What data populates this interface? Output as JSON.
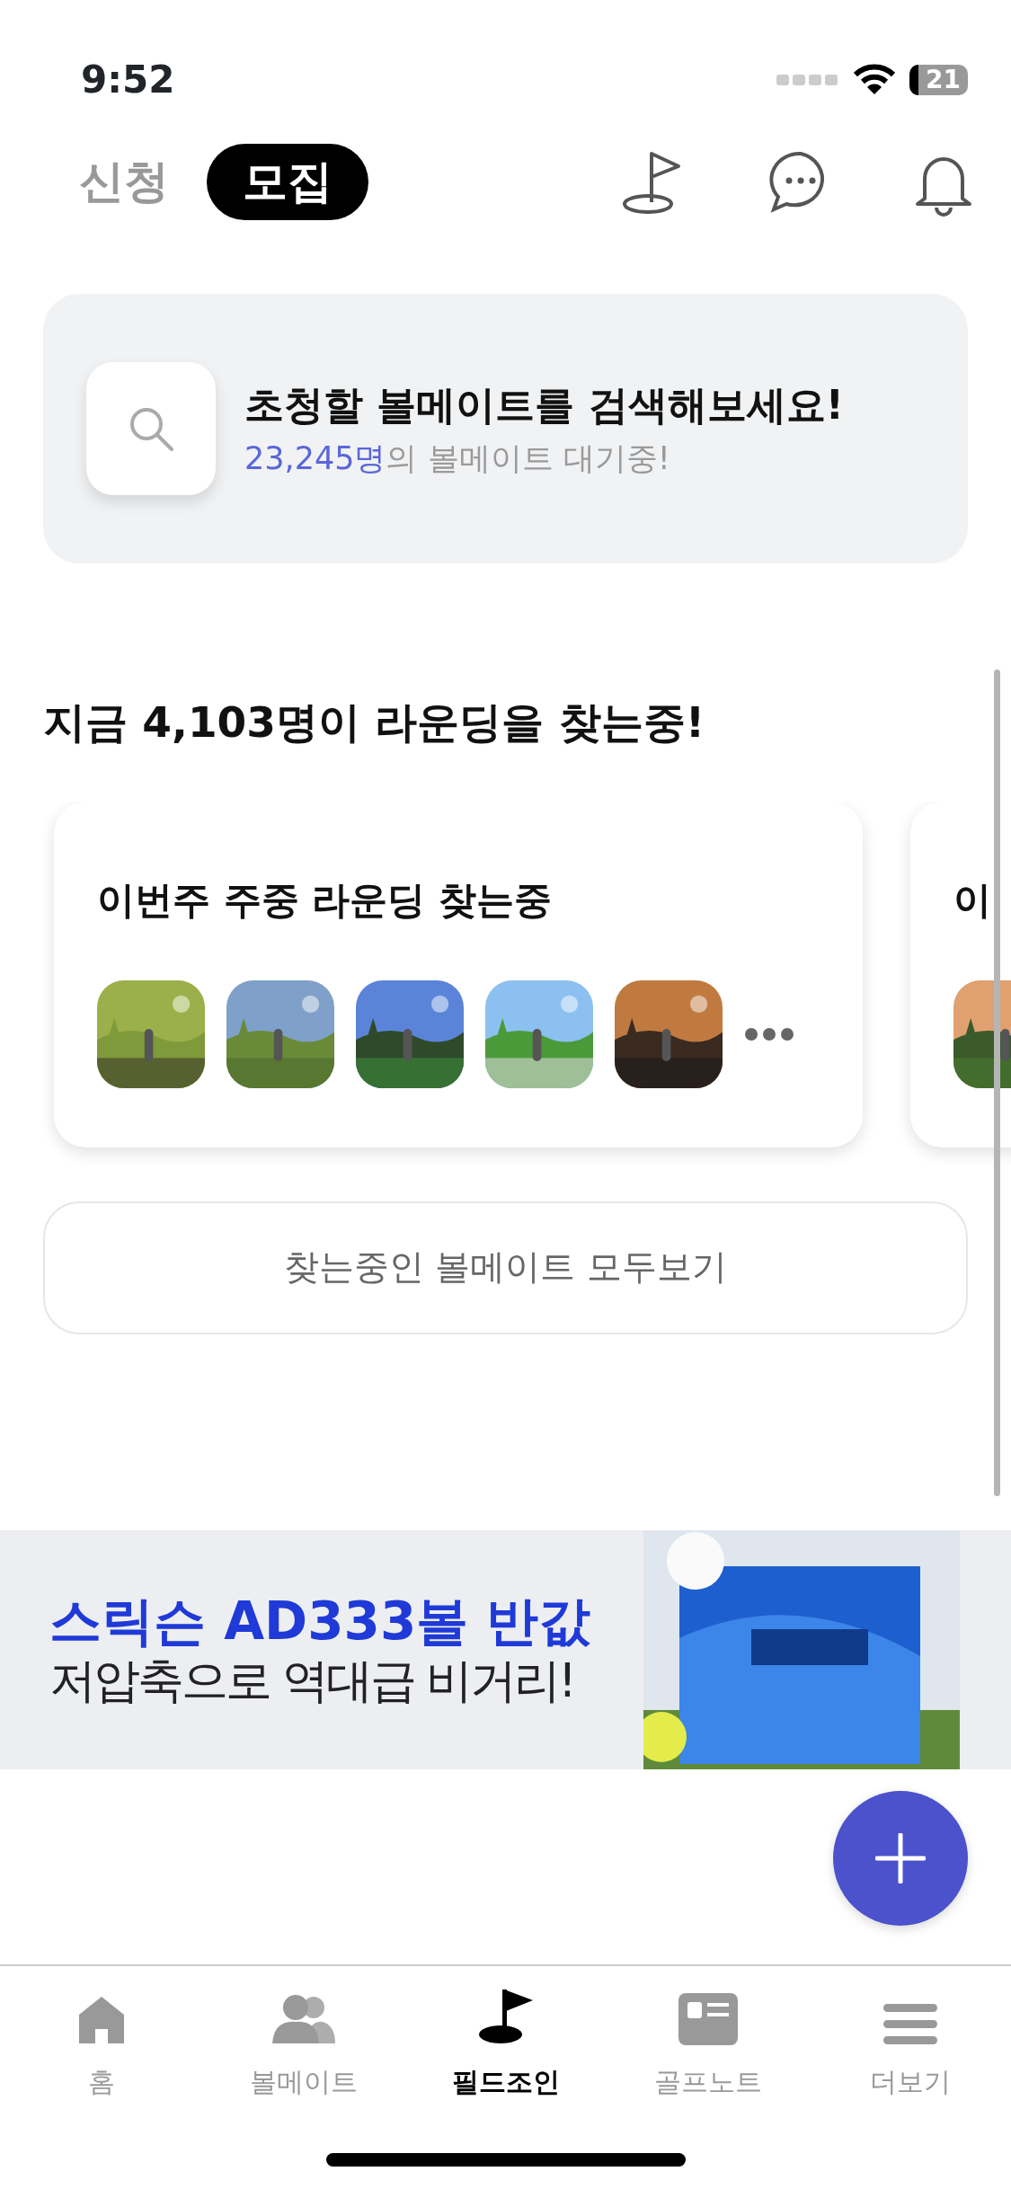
{
  "status_bar": {
    "time": "9:52",
    "battery": "21"
  },
  "tabs": [
    {
      "label": "신청",
      "selected": false
    },
    {
      "label": "모집",
      "selected": true
    }
  ],
  "search_card": {
    "title": "초청할 볼메이트를 검색해보세요!",
    "count": "23,245명",
    "suffix": "의 볼메이트 대기중!"
  },
  "heading": "지금 4,103명이 라운딩을 찾는중!",
  "cards": [
    {
      "title": "이번주 주중 라운딩 찾는중",
      "more": true
    },
    {
      "title": "이",
      "more": false
    }
  ],
  "view_all_button": "찾는중인 볼메이트 모두보기",
  "ad_banner": {
    "headline": "스릭슨 AD333볼 반값",
    "subline": "저압축으로 역대급 비거리!"
  },
  "nav": [
    {
      "label": "홈",
      "kind": "home",
      "selected": false
    },
    {
      "label": "볼메이트",
      "kind": "people",
      "selected": false
    },
    {
      "label": "필드조인",
      "kind": "flag",
      "selected": true
    },
    {
      "label": "골프노트",
      "kind": "note",
      "selected": false
    },
    {
      "label": "더보기",
      "kind": "menu",
      "selected": false
    }
  ]
}
